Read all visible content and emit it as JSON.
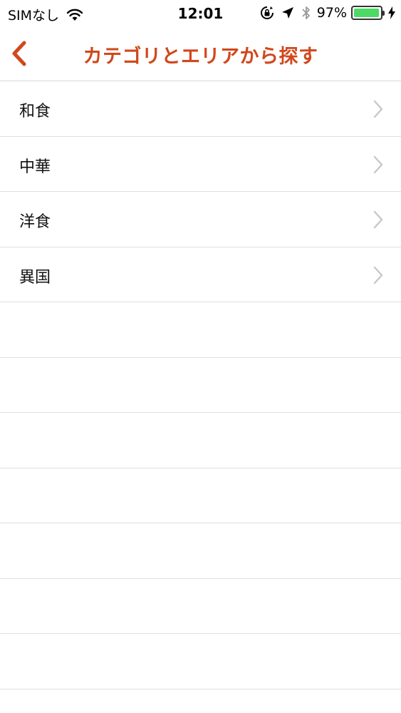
{
  "status_bar": {
    "carrier": "SIMなし",
    "time": "12:01",
    "battery_percent": "97%",
    "battery_level": 0.97,
    "battery_color": "#4cd964"
  },
  "nav": {
    "title": "カテゴリとエリアから探す",
    "back_icon": "chevron-left-icon",
    "accent_color": "#d0481c"
  },
  "categories": [
    {
      "label": "和食"
    },
    {
      "label": "中華"
    },
    {
      "label": "洋食"
    },
    {
      "label": "異国"
    }
  ],
  "empty_rows": 7
}
